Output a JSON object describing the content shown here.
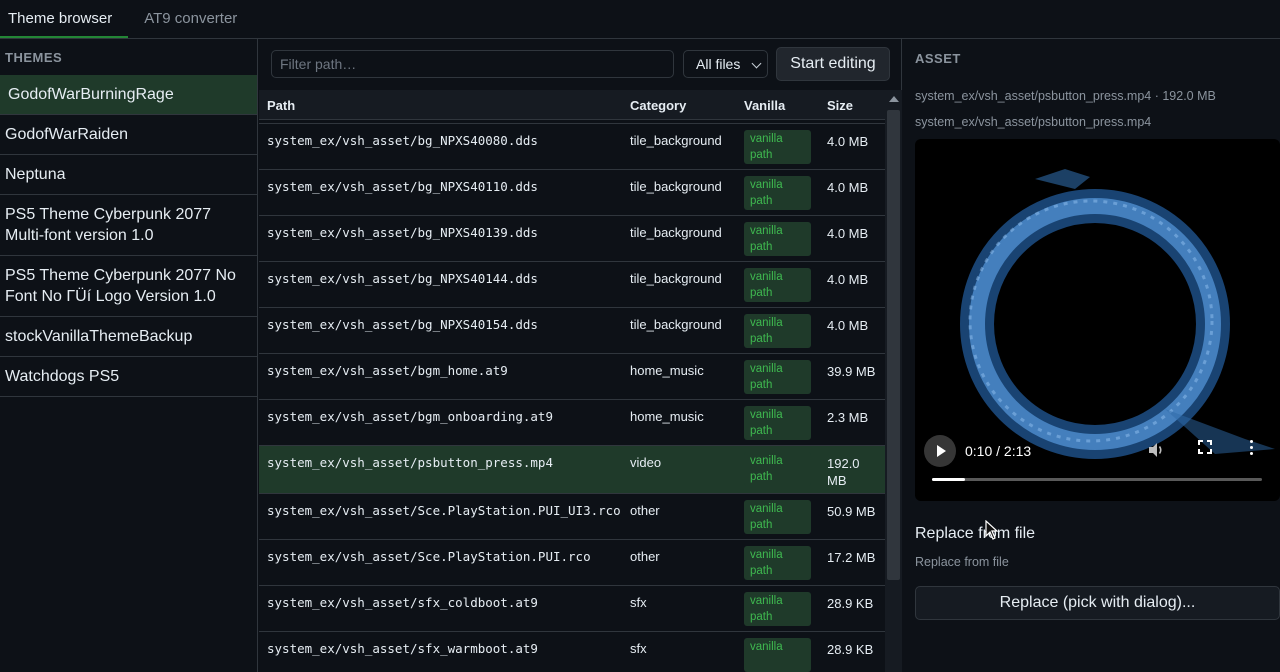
{
  "tabs": [
    {
      "label": "Theme browser",
      "active": true
    },
    {
      "label": "AT9 converter",
      "active": false
    }
  ],
  "sidebar": {
    "heading": "THEMES",
    "items": [
      {
        "label": "GodofWarBurningRage",
        "selected": true
      },
      {
        "label": "GodofWarRaiden"
      },
      {
        "label": "Neptuna"
      },
      {
        "label": "PS5 Theme Cyberpunk 2077 Multi-font version 1.0"
      },
      {
        "label": "PS5 Theme Cyberpunk 2077 No Font No ΓÜí Logo Version 1.0"
      },
      {
        "label": "stockVanillaThemeBackup"
      },
      {
        "label": "Watchdogs PS5"
      }
    ]
  },
  "toolbar": {
    "filter_placeholder": "Filter path…",
    "filter_value": "",
    "scope_selected": "All files",
    "edit_label": "Start editing"
  },
  "table": {
    "headers": {
      "path": "Path",
      "category": "Category",
      "vanilla": "Vanilla",
      "size": "Size"
    },
    "rows": [
      {
        "path": "",
        "category": "",
        "vanilla": "path",
        "size": "",
        "partial": true
      },
      {
        "path": "system_ex/vsh_asset/bg_NPXS40080.dds",
        "category": "tile_background",
        "vanilla": "vanilla path",
        "size": "4.0 MB"
      },
      {
        "path": "system_ex/vsh_asset/bg_NPXS40110.dds",
        "category": "tile_background",
        "vanilla": "vanilla path",
        "size": "4.0 MB"
      },
      {
        "path": "system_ex/vsh_asset/bg_NPXS40139.dds",
        "category": "tile_background",
        "vanilla": "vanilla path",
        "size": "4.0 MB"
      },
      {
        "path": "system_ex/vsh_asset/bg_NPXS40144.dds",
        "category": "tile_background",
        "vanilla": "vanilla path",
        "size": "4.0 MB"
      },
      {
        "path": "system_ex/vsh_asset/bg_NPXS40154.dds",
        "category": "tile_background",
        "vanilla": "vanilla path",
        "size": "4.0 MB"
      },
      {
        "path": "system_ex/vsh_asset/bgm_home.at9",
        "category": "home_music",
        "vanilla": "vanilla path",
        "size": "39.9 MB"
      },
      {
        "path": "system_ex/vsh_asset/bgm_onboarding.at9",
        "category": "home_music",
        "vanilla": "vanilla path",
        "size": "2.3 MB"
      },
      {
        "path": "system_ex/vsh_asset/psbutton_press.mp4",
        "category": "video",
        "vanilla": "vanilla path",
        "size": "192.0 MB",
        "selected": true
      },
      {
        "path": "system_ex/vsh_asset/Sce.PlayStation.PUI_UI3.rco",
        "category": "other",
        "vanilla": "vanilla path",
        "size": "50.9 MB"
      },
      {
        "path": "system_ex/vsh_asset/Sce.PlayStation.PUI.rco",
        "category": "other",
        "vanilla": "vanilla path",
        "size": "17.2 MB"
      },
      {
        "path": "system_ex/vsh_asset/sfx_coldboot.at9",
        "category": "sfx",
        "vanilla": "vanilla path",
        "size": "28.9 KB"
      },
      {
        "path": "system_ex/vsh_asset/sfx_warmboot.at9",
        "category": "sfx",
        "vanilla": "vanilla",
        "size": "28.9 KB"
      }
    ]
  },
  "asset": {
    "heading": "ASSET",
    "meta_line": "system_ex/vsh_asset/psbutton_press.mp4 · 192.0 MB",
    "path_line": "system_ex/vsh_asset/psbutton_press.mp4",
    "player": {
      "time": "0:10 / 2:13",
      "progress": 0.1
    },
    "replace_title": "Replace from file",
    "replace_subtitle": "Replace from file",
    "replace_button": "Replace (pick with dialog)..."
  },
  "icons": [
    "chevron-down-icon",
    "play-icon",
    "volume-icon",
    "fullscreen-icon",
    "more-vertical-icon",
    "scroll-up-icon",
    "mouse-cursor-icon"
  ],
  "colors": {
    "accent": "#238636",
    "selected_bg": "#1f3a2a",
    "vanilla_text": "#3fb950",
    "background": "#0d1117"
  }
}
